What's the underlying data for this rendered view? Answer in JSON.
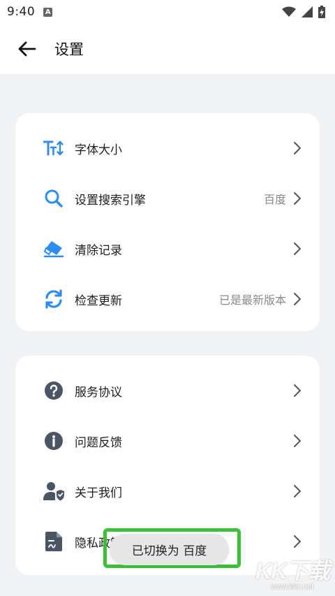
{
  "status_bar": {
    "time": "9:40",
    "badge": "A"
  },
  "header": {
    "title": "设置"
  },
  "group1": [
    {
      "label": "字体大小",
      "value": ""
    },
    {
      "label": "设置搜索引擎",
      "value": "百度"
    },
    {
      "label": "清除记录",
      "value": ""
    },
    {
      "label": "检查更新",
      "value": "已是最新版本"
    }
  ],
  "group2": [
    {
      "label": "服务协议",
      "value": ""
    },
    {
      "label": "问题反馈",
      "value": ""
    },
    {
      "label": "关于我们",
      "value": ""
    },
    {
      "label": "隐私政策",
      "value": ""
    }
  ],
  "toast": {
    "text": "已切换为 百度"
  },
  "watermark": {
    "title": "KK下载",
    "url": "www.kkx.net"
  },
  "colors": {
    "accent_blue": "#2d8cf0",
    "icon_gray": "#4b5563",
    "toast_border": "#3dbf3a"
  }
}
